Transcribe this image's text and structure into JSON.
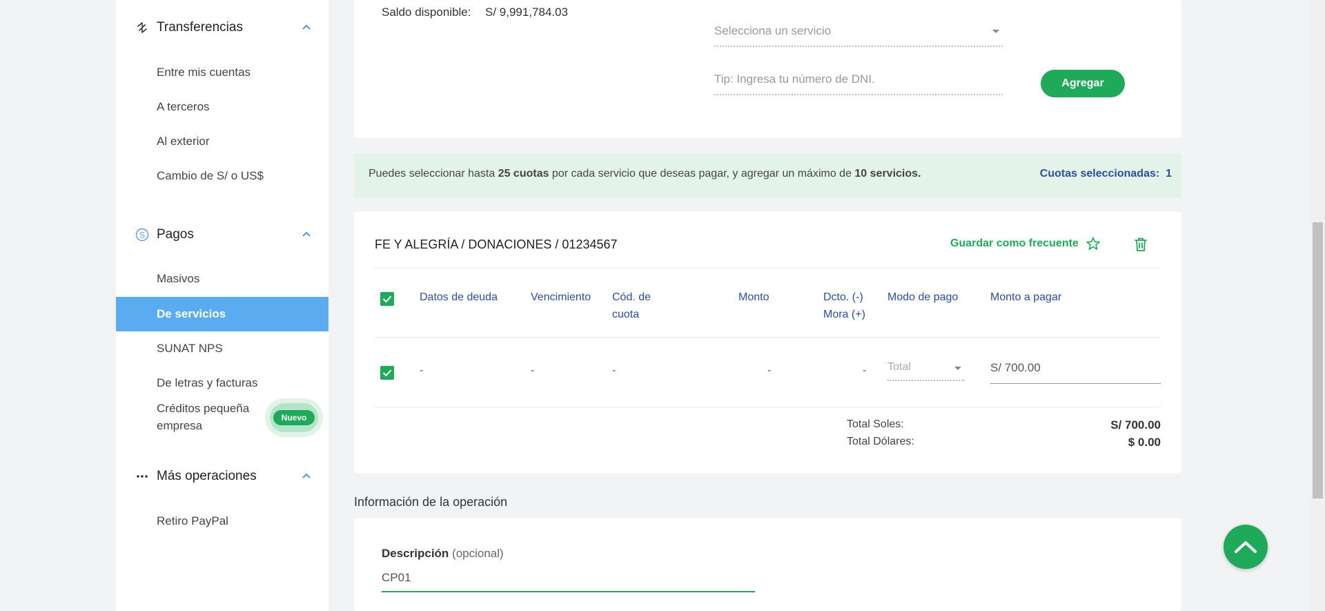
{
  "sidebar": {
    "transferencias": {
      "title": "Transferencias",
      "items": [
        "Entre mis cuentas",
        "A terceros",
        "Al exterior",
        "Cambio de S/ o US$"
      ]
    },
    "pagos": {
      "title": "Pagos",
      "items": [
        "Masivos",
        "De servicios",
        "SUNAT NPS",
        "De letras y facturas",
        "Créditos pequeña empresa"
      ],
      "badge": "Nuevo",
      "active": "De servicios"
    },
    "mas_operaciones": {
      "title": "Más operaciones",
      "items": [
        "Retiro PayPal"
      ]
    }
  },
  "top_card": {
    "saldo_label": "Saldo disponible:",
    "saldo_value": "S/ 9,991,784.03",
    "service_placeholder": "Selecciona un servicio",
    "dni_placeholder": "Tip: Ingresa tu número de DNI.",
    "add_button": "Agregar"
  },
  "info_bar": {
    "text_1": "Puedes seleccionar hasta ",
    "bold_1": "25 cuotas",
    "text_2": " por cada servicio que deseas pagar, y agregar un máximo de ",
    "bold_2": "10 servicios.",
    "selected_label": "Cuotas seleccionadas:",
    "selected_count": "1"
  },
  "service_card": {
    "title": "FE Y ALEGRÍA / DONACIONES / 01234567",
    "save_frequent": "Guardar como frecuente",
    "headers": {
      "datos": "Datos de deuda",
      "vencimiento": "Vencimiento",
      "cod_1": "Cód. de",
      "cod_2": "cuota",
      "monto": "Monto",
      "dcto": "Dcto. (-)",
      "mora": "Mora (+)",
      "modo": "Modo de pago",
      "monto_pagar": "Monto a pagar"
    },
    "row": {
      "datos": "-",
      "vencimiento": "-",
      "cod": "-",
      "monto": "-",
      "dcto": "-",
      "modo": "Total",
      "monto_pagar": "S/ 700.00"
    },
    "total_soles_label": "Total Soles:",
    "total_soles_value": "S/ 700.00",
    "total_dolares_label": "Total Dólares:",
    "total_dolares_value": "$ 0.00"
  },
  "operation": {
    "section_title": "Información de la operación",
    "desc_label": "Descripción",
    "desc_optional": "(opcional)",
    "desc_value": "CP01"
  },
  "colors": {
    "green": "#1faa5a",
    "blue_header": "#2a4e9e",
    "active_nav": "#5aabf0"
  }
}
